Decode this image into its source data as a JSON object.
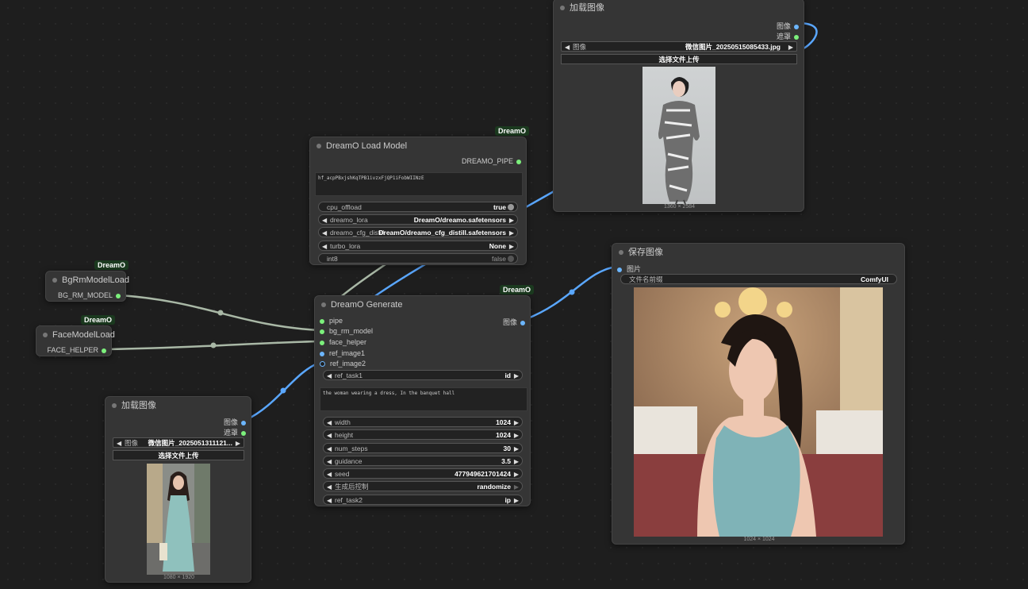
{
  "badge_label": "DreamO",
  "load_image_top": {
    "title": "加载图像",
    "out_image": "图像",
    "out_mask": "遮罩",
    "image_label": "图像",
    "image_value": "微信图片_20250515085433.jpg",
    "upload_label": "选择文件上传",
    "dims": "1360 × 2584"
  },
  "load_model": {
    "title": "DreamO Load Model",
    "out_pipe": "DREAMO_PIPE",
    "token_text": "hf_acpPBxjshKqTPB1ivzxFjQP1iFobWIINzE",
    "widgets": [
      {
        "label": "cpu_offload",
        "value": "true"
      },
      {
        "label": "dreamo_lora",
        "value": "DreamO/dreamo.safetensors"
      },
      {
        "label": "dreamo_cfg_distill",
        "value": "DreamO/dreamo_cfg_distill.safetensors"
      },
      {
        "label": "turbo_lora",
        "value": "None"
      },
      {
        "label": "int8",
        "value": "false"
      }
    ]
  },
  "bgrm": {
    "title": "BgRmModelLoad",
    "out": "BG_RM_MODEL"
  },
  "face": {
    "title": "FaceModelLoad",
    "out": "FACE_HELPER"
  },
  "generate": {
    "title": "DreamO Generate",
    "inputs": [
      "pipe",
      "bg_rm_model",
      "face_helper",
      "ref_image1",
      "ref_image2"
    ],
    "out_image": "图像",
    "ref_task1": {
      "label": "ref_task1",
      "value": "id"
    },
    "prompt": "the woman wearing a dress, In the banquet hall",
    "widgets": [
      {
        "label": "width",
        "value": "1024"
      },
      {
        "label": "height",
        "value": "1024"
      },
      {
        "label": "num_steps",
        "value": "30"
      },
      {
        "label": "guidance",
        "value": "3.5"
      },
      {
        "label": "seed",
        "value": "477949621701424"
      },
      {
        "label": "生成后控制",
        "value": "randomize"
      },
      {
        "label": "ref_task2",
        "value": "ip"
      }
    ]
  },
  "load_image_bottom": {
    "title": "加载图像",
    "out_image": "图像",
    "out_mask": "遮罩",
    "image_label": "图像",
    "image_value": "微信图片_2025051311121...",
    "upload_label": "选择文件上传",
    "dims": "1080 × 1920"
  },
  "save_image": {
    "title": "保存图像",
    "in_images": "图片",
    "prefix_label": "文件名前缀",
    "prefix_value": "ComfyUI",
    "dims": "1024 × 1024"
  },
  "colors": {
    "link_image": "#5aa7ff",
    "link_model": "#a9b8a6",
    "port_green": "#7cf07c",
    "port_blue": "#6cb6ff"
  }
}
